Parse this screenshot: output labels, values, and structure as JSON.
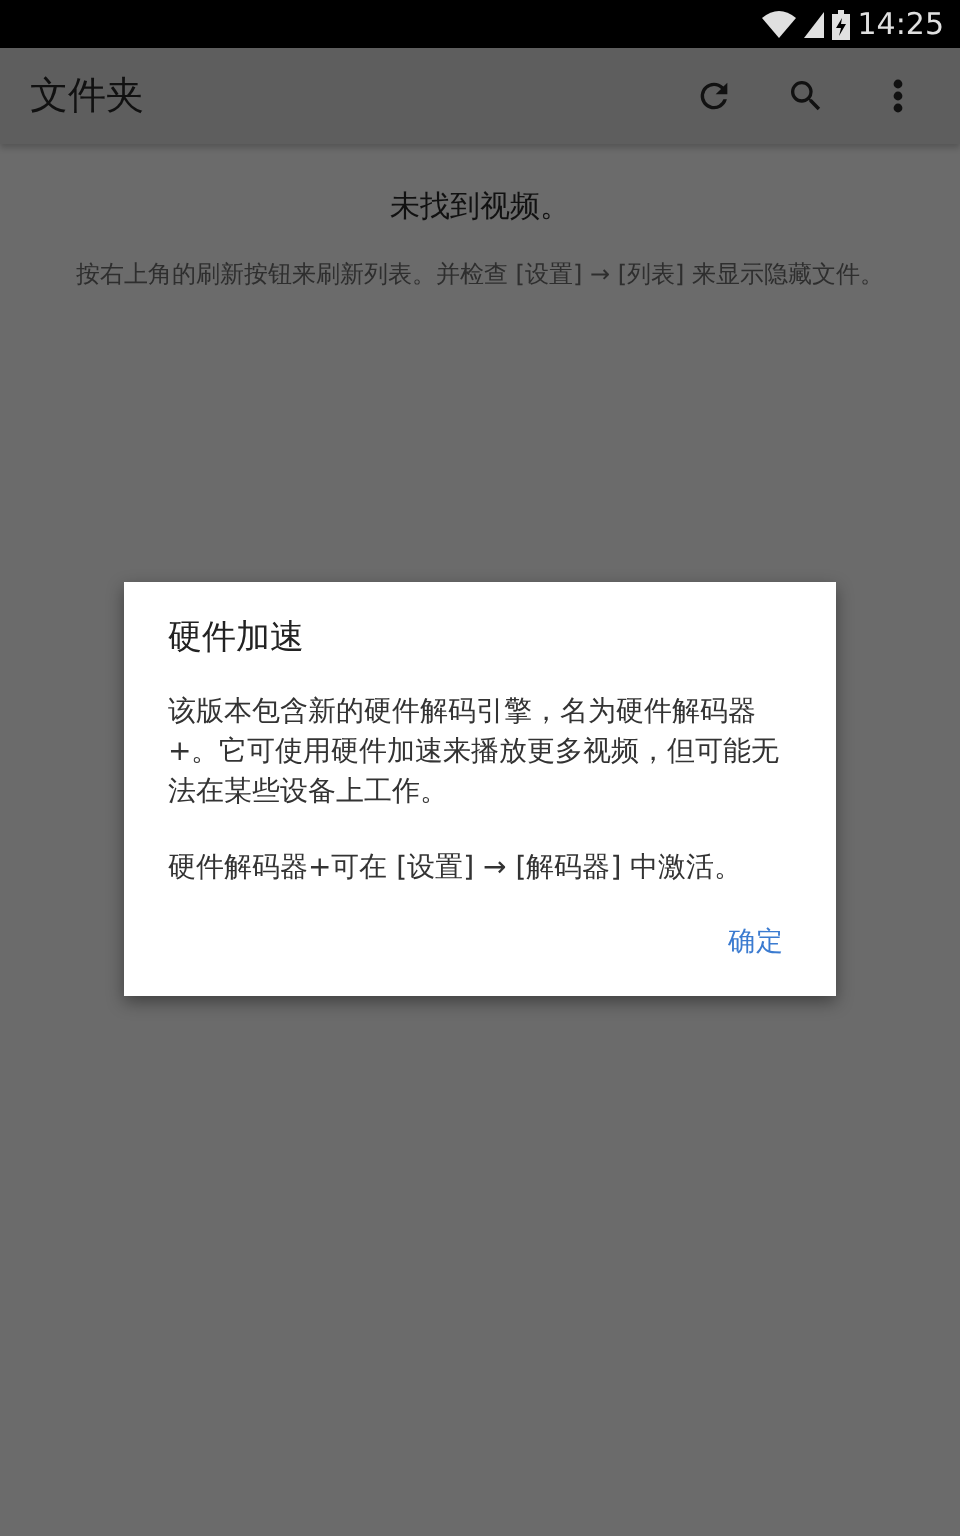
{
  "status_bar": {
    "time": "14:25"
  },
  "app_bar": {
    "title": "文件夹"
  },
  "empty_state": {
    "title": "未找到视频。",
    "message": "按右上角的刷新按钮来刷新列表。并检查 [设置] → [列表] 来显示隐藏文件。"
  },
  "dialog": {
    "title": "硬件加速",
    "paragraphs": [
      "该版本包含新的硬件解码引擎，名为硬件解码器+。它可使用硬件加速来播放更多视频，但可能无法在某些设备上工作。",
      "硬件解码器+可在 [设置] → [解码器] 中激活。"
    ],
    "button": "确定"
  }
}
